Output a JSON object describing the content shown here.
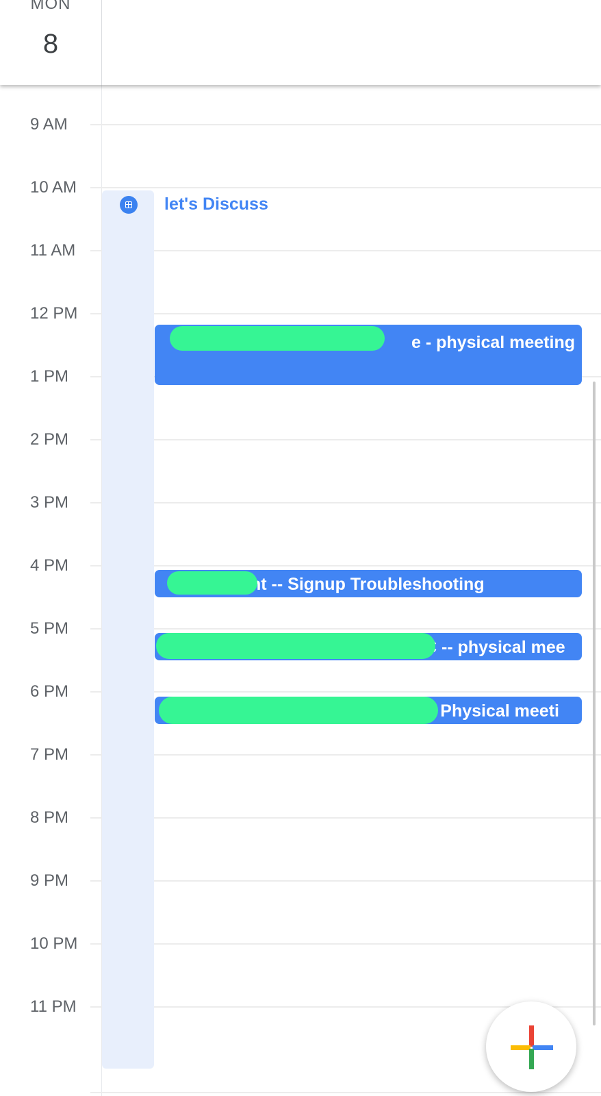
{
  "header": {
    "day_name": "MON",
    "day_number": "8"
  },
  "hours": [
    "9 AM",
    "10 AM",
    "11 AM",
    "12 PM",
    "1 PM",
    "2 PM",
    "3 PM",
    "4 PM",
    "5 PM",
    "6 PM",
    "7 PM",
    "8 PM",
    "9 PM",
    "10 PM",
    "11 PM"
  ],
  "task": {
    "title": "let's Discuss",
    "icon": "task-icon"
  },
  "events": [
    {
      "title": "e - physical meeting"
    },
    {
      "title": "nt -- Signup Troubleshooting"
    },
    {
      "title": "C -- physical mee"
    },
    {
      "title": "- Physical meeti"
    }
  ],
  "fab": {
    "icon": "plus-icon"
  },
  "colors": {
    "event": "#4285f4",
    "task_strip": "#e8effc",
    "redaction": "#36f594"
  }
}
